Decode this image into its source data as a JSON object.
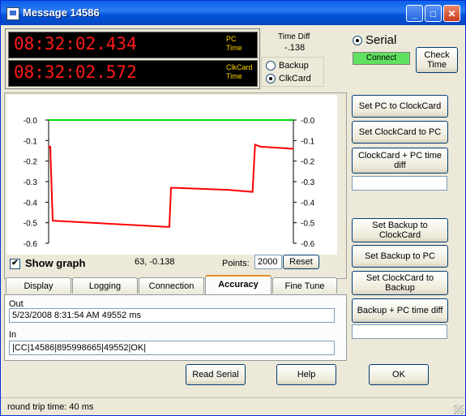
{
  "window": {
    "title": "Message 14586",
    "minimize": "_",
    "maximize": "□",
    "close": "✕"
  },
  "clocks": {
    "pc_time": "08:32:02.434",
    "pc_label_1": "PC",
    "pc_label_2": "Time",
    "card_time": "08:32:02.572",
    "card_label_1": "ClkCard",
    "card_label_2": "Time"
  },
  "time_diff": {
    "label": "Time Diff",
    "value": "-.138"
  },
  "source": {
    "backup": "Backup",
    "clkcard": "ClkCard",
    "selected": "ClkCard"
  },
  "serial": {
    "label": "Serial",
    "status": "Connect",
    "status_color": "#5fe05f",
    "check_time": "Check Time"
  },
  "right_buttons": {
    "set_pc_to_clockcard": "Set PC to ClockCard",
    "set_clockcard_to_pc": "Set ClockCard to PC",
    "clockcard_pc_diff": "ClockCard + PC time diff",
    "clockcard_pc_diff_value": "",
    "set_backup_to_clockcard": "Set Backup to ClockCard",
    "set_backup_to_pc": "Set Backup to PC",
    "set_clockcard_to_backup": "Set ClockCard to Backup",
    "backup_pc_diff": "Backup + PC time diff",
    "backup_pc_diff_value": ""
  },
  "graph": {
    "show_graph_label": "Show graph",
    "show_graph_checked": "✔",
    "cursor_value": "63,  -0.138",
    "points_label": "Points:",
    "points_value": "2000",
    "reset_label": "Reset"
  },
  "chart_data": {
    "type": "line",
    "ylim": [
      -0.6,
      0.0
    ],
    "yticks": [
      "-0.0",
      "-0.1",
      "-0.2",
      "-0.3",
      "-0.4",
      "-0.5",
      "-0.6"
    ],
    "reference_color": "#00dd00",
    "series_color": "#ff0000",
    "series": [
      {
        "name": "",
        "x": [
          0,
          2,
          5,
          145,
          148,
          150,
          155,
          220,
          250,
          253,
          260,
          300
        ],
        "y": [
          -0.13,
          -0.13,
          -0.49,
          -0.52,
          -0.52,
          -0.33,
          -0.33,
          -0.34,
          -0.35,
          -0.12,
          -0.13,
          -0.14
        ]
      }
    ]
  },
  "tabs": [
    "Display",
    "Logging",
    "Connection",
    "Accuracy",
    "Fine Tune"
  ],
  "active_tab": "Accuracy",
  "io": {
    "out_label": "Out",
    "out_value": "5/23/2008 8:31:54 AM 49552 ms",
    "in_label": "In",
    "in_value": "|CC|14586|895998665|49552|OK|"
  },
  "bottom_buttons": {
    "read_serial": "Read Serial",
    "help": "Help",
    "ok": "OK"
  },
  "status": {
    "text": "round trip time: 40 ms"
  }
}
